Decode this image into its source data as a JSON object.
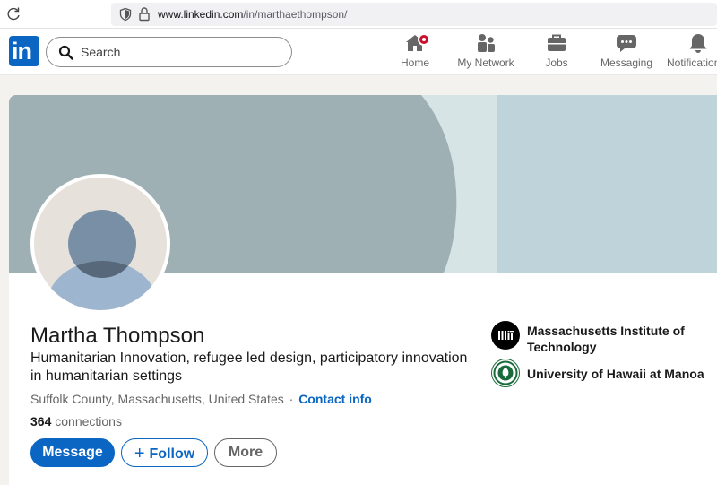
{
  "browser": {
    "url_host": "www.linkedin.com",
    "url_path": "/in/marthaethompson/"
  },
  "nav": {
    "search_placeholder": "Search",
    "items": [
      {
        "label": "Home",
        "icon": "home-icon"
      },
      {
        "label": "My Network",
        "icon": "network-icon"
      },
      {
        "label": "Jobs",
        "icon": "briefcase-icon"
      },
      {
        "label": "Messaging",
        "icon": "messaging-icon"
      },
      {
        "label": "Notifications",
        "icon": "bell-icon"
      }
    ]
  },
  "profile": {
    "name": "Martha Thompson",
    "headline": "Humanitarian Innovation, refugee led design, participatory innovation in humanitarian settings",
    "location": "Suffolk County, Massachusetts, United States",
    "separator": "·",
    "contact_info": "Contact info",
    "connections_count": "364",
    "connections_label": "connections",
    "buttons": {
      "message": "Message",
      "follow": "Follow",
      "more": "More"
    },
    "education": [
      {
        "name": "Massachusetts Institute of Technology",
        "logo": "mit-logo"
      },
      {
        "name": "University of Hawaii at Manoa",
        "logo": "uh-manoa-seal"
      }
    ]
  },
  "colors": {
    "brand": "#0a66c2",
    "notification": "#cb112d",
    "cover_dark": "#9eb0b4",
    "cover_mid": "#d7e4e5",
    "cover_light": "#bfd4da"
  }
}
